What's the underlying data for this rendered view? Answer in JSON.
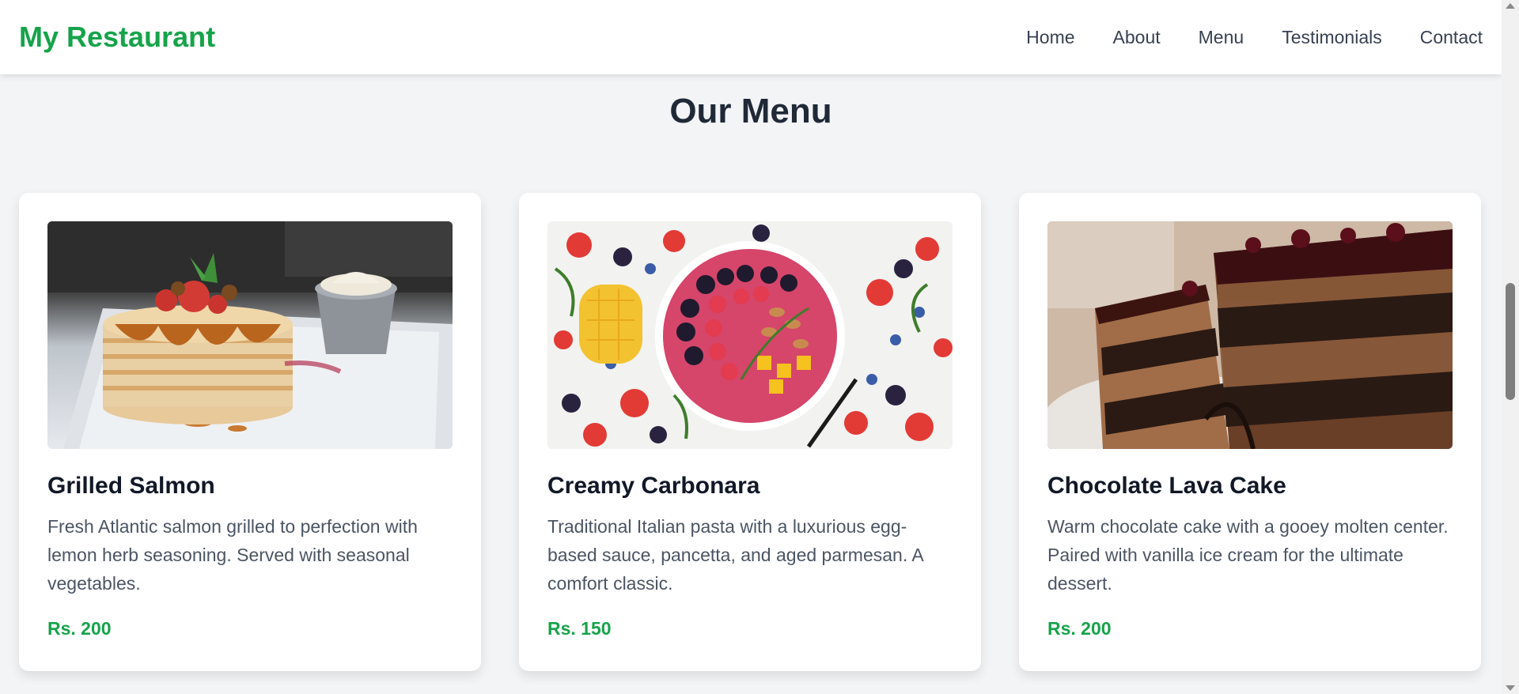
{
  "header": {
    "brand": "My Restaurant",
    "nav": [
      "Home",
      "About",
      "Menu",
      "Testimonials",
      "Contact"
    ]
  },
  "menu": {
    "title": "Our Menu",
    "items": [
      {
        "name": "Grilled Salmon",
        "description": "Fresh Atlantic salmon grilled to perfection with lemon herb seasoning. Served with seasonal vegetables.",
        "price": "Rs. 200",
        "image": "pancakes-photo"
      },
      {
        "name": "Creamy Carbonara",
        "description": "Traditional Italian pasta with a luxurious egg-based sauce, pancetta, and aged parmesan. A comfort classic.",
        "price": "Rs. 150",
        "image": "smoothie-bowl-photo"
      },
      {
        "name": "Chocolate Lava Cake",
        "description": "Warm chocolate cake with a gooey molten center. Paired with vanilla ice cream for the ultimate dessert.",
        "price": "Rs. 200",
        "image": "chocolate-cake-photo"
      }
    ]
  },
  "colors": {
    "brand": "#16a34a",
    "background": "#f3f4f6",
    "text": "#1f2937"
  }
}
